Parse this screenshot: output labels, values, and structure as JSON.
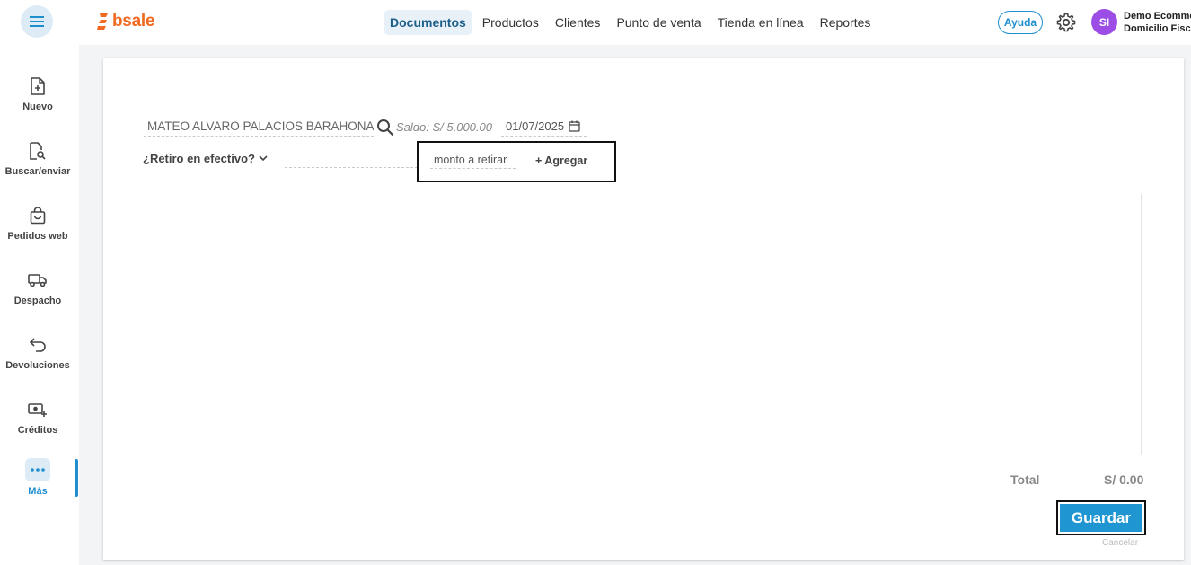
{
  "header": {
    "logo_text": "bsale",
    "nav": [
      {
        "label": "Documentos",
        "active": true
      },
      {
        "label": "Productos",
        "active": false
      },
      {
        "label": "Clientes",
        "active": false
      },
      {
        "label": "Punto de venta",
        "active": false
      },
      {
        "label": "Tienda en línea",
        "active": false
      },
      {
        "label": "Reportes",
        "active": false
      }
    ],
    "help_label": "Ayuda",
    "avatar_initials": "SI",
    "company_line1": "Demo Ecommerce",
    "company_line2": "Domicilio Fiscal"
  },
  "sidebar": {
    "items": [
      {
        "label": "Nuevo",
        "icon": "file-plus-icon"
      },
      {
        "label": "Buscar/enviar",
        "icon": "file-search-icon"
      },
      {
        "label": "Pedidos web",
        "icon": "shopping-bag-icon"
      },
      {
        "label": "Despacho",
        "icon": "truck-icon"
      },
      {
        "label": "Devoluciones",
        "icon": "return-arrow-icon"
      },
      {
        "label": "Créditos",
        "icon": "money-plus-icon"
      },
      {
        "label": "Más",
        "icon": "more-dots-icon",
        "active": true
      }
    ]
  },
  "form": {
    "client_name": "MATEO ALVARO PALACIOS BARAHONA",
    "saldo": "Saldo: S/ 5,000.00",
    "date": "01/07/2025",
    "retiro_label": "¿Retiro en efectivo?",
    "monto_placeholder": "monto a retirar",
    "agregar_label": "+ Agregar"
  },
  "summary": {
    "total_label": "Total",
    "total_value": "S/ 0.00"
  },
  "actions": {
    "guardar_label": "Guardar",
    "cancelar_label": "Cancelar"
  },
  "colors": {
    "brand": "#f26a21",
    "accent": "#1f95d1",
    "avatar": "#9b4de6"
  }
}
